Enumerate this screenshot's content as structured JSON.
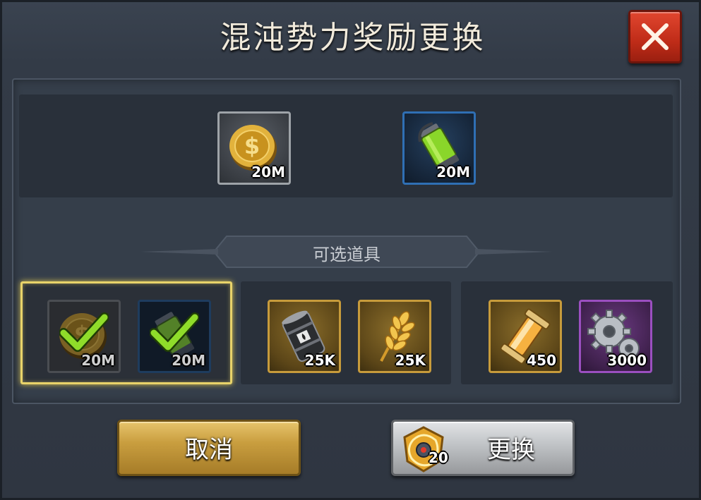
{
  "dialog": {
    "title": "混沌势力奖励更换",
    "close_icon": "close-x-icon"
  },
  "current_rewards": [
    {
      "icon": "gold-coin-icon",
      "qty": "20M",
      "frame": "grey"
    },
    {
      "icon": "green-canister-icon",
      "qty": "20M",
      "frame": "blue"
    }
  ],
  "section": {
    "title": "可选道具"
  },
  "options": [
    {
      "selected": true,
      "items": [
        {
          "icon": "gold-coin-icon",
          "qty": "20M",
          "checked": true
        },
        {
          "icon": "green-canister-icon",
          "qty": "20M",
          "checked": true
        }
      ]
    },
    {
      "selected": false,
      "items": [
        {
          "icon": "oil-barrel-icon",
          "qty": "25K"
        },
        {
          "icon": "wheat-icon",
          "qty": "25K"
        }
      ]
    },
    {
      "selected": false,
      "items": [
        {
          "icon": "energy-capsule-icon",
          "qty": "450"
        },
        {
          "icon": "gears-icon",
          "qty": "3000"
        }
      ]
    }
  ],
  "buttons": {
    "cancel_label": "取消",
    "exchange_label": "更换",
    "exchange_cost_icon": "chaos-token-icon",
    "exchange_cost_qty": "20"
  },
  "colors": {
    "selection_highlight": "#e8d36a",
    "close_button": "#c9321c",
    "cancel_button": "#c99e3f",
    "exchange_button": "#bfc2c5"
  }
}
